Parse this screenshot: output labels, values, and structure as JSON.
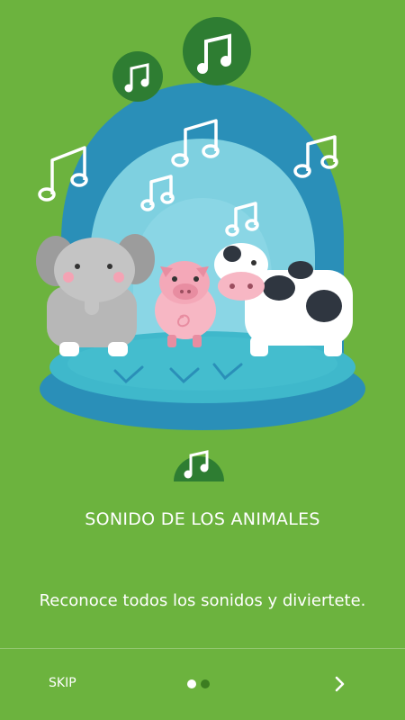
{
  "title": "SONIDO DE LOS ANIMALES",
  "subtitle": "Reconoce todos los sonidos y diviertete.",
  "nav": {
    "skip_label": "SKIP",
    "next_icon": "chevron-right-icon",
    "page_count": 2,
    "current_page": 1
  },
  "colors": {
    "background": "#6cb33e",
    "dome_outer": "#2a8fb8",
    "dome_inner": "#7ed0e0",
    "note_badge": "#2e7d32",
    "dot_active": "#ffffff",
    "dot_inactive": "#3c7d21"
  },
  "illustration": {
    "animals": [
      "elephant",
      "pig",
      "cow"
    ],
    "icons": [
      "music-note-icon"
    ]
  }
}
